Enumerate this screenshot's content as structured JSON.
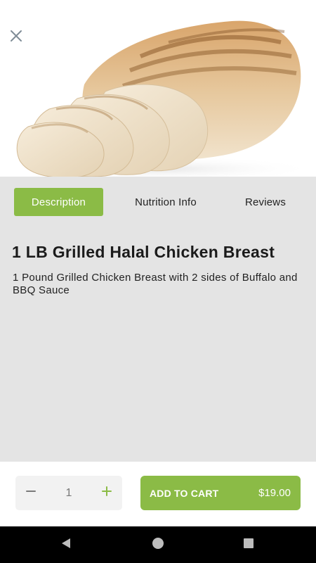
{
  "product": {
    "image_icon": "grilled-chicken-breast-photo",
    "title": "1 LB Grilled Halal Chicken Breast",
    "description": "1 Pound Grilled Chicken Breast with 2 sides of Buffalo and BBQ Sauce"
  },
  "header": {
    "close_icon": "close-icon"
  },
  "tabs": [
    {
      "label": "Description",
      "active": true
    },
    {
      "label": "Nutrition Info",
      "active": false
    },
    {
      "label": "Reviews",
      "active": false
    }
  ],
  "cart": {
    "quantity": "1",
    "minus_icon": "minus-icon",
    "plus_icon": "plus-icon",
    "add_label": "ADD TO CART",
    "price": "$19.00"
  },
  "navbar": {
    "back_icon": "back-icon",
    "home_icon": "home-icon",
    "recents_icon": "recents-icon"
  },
  "colors": {
    "accent": "#8bbb46",
    "content_bg": "#e4e4e4",
    "navbar_bg": "#000000"
  }
}
